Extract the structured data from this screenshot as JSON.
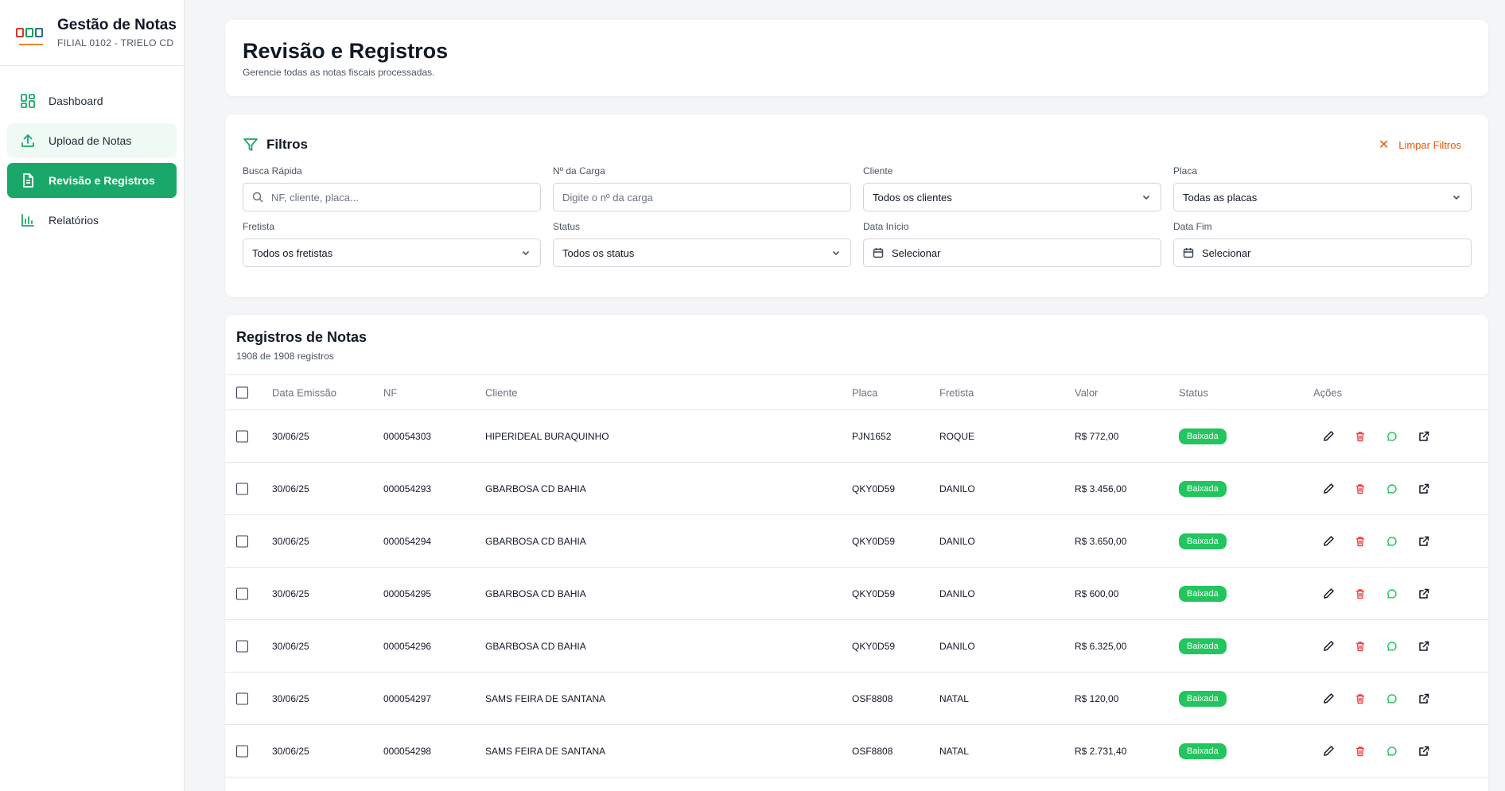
{
  "brand": {
    "title": "Gestão de Notas",
    "subtitle": "FILIAL 0102 - TRIELO CD"
  },
  "sidebar": {
    "items": [
      {
        "label": "Dashboard",
        "icon": "dashboard-grid-icon"
      },
      {
        "label": "Upload de Notas",
        "icon": "upload-icon"
      },
      {
        "label": "Revisão e Registros",
        "icon": "document-icon"
      },
      {
        "label": "Relatórios",
        "icon": "bar-chart-icon"
      }
    ]
  },
  "header": {
    "title": "Revisão e Registros",
    "subtitle": "Gerencie todas as notas fiscais processadas."
  },
  "filters": {
    "title": "Filtros",
    "clear_label": "Limpar Filtros",
    "busca": {
      "label": "Busca Rápida",
      "placeholder": "NF, cliente, placa..."
    },
    "carga": {
      "label": "Nº da Carga",
      "placeholder": "Digite o nº da carga"
    },
    "cliente": {
      "label": "Cliente",
      "value": "Todos os clientes"
    },
    "placa": {
      "label": "Placa",
      "value": "Todas as placas"
    },
    "fretista": {
      "label": "Fretista",
      "value": "Todos os fretistas"
    },
    "status": {
      "label": "Status",
      "value": "Todos os status"
    },
    "data_inicio": {
      "label": "Data Início",
      "value": "Selecionar"
    },
    "data_fim": {
      "label": "Data Fim",
      "value": "Selecionar"
    }
  },
  "table": {
    "title": "Registros de Notas",
    "count": "1908 de 1908 registros",
    "columns": {
      "data": "Data Emissão",
      "nf": "NF",
      "cliente": "Cliente",
      "placa": "Placa",
      "fretista": "Fretista",
      "valor": "Valor",
      "status": "Status",
      "acoes": "Ações"
    },
    "rows": [
      {
        "data": "30/06/25",
        "nf": "000054303",
        "cliente": "HIPERIDEAL BURAQUINHO",
        "placa": "PJN1652",
        "fretista": "ROQUE",
        "valor": "R$ 772,00",
        "status": "Baixada"
      },
      {
        "data": "30/06/25",
        "nf": "000054293",
        "cliente": "GBARBOSA CD BAHIA",
        "placa": "QKY0D59",
        "fretista": "DANILO",
        "valor": "R$ 3.456,00",
        "status": "Baixada"
      },
      {
        "data": "30/06/25",
        "nf": "000054294",
        "cliente": "GBARBOSA CD BAHIA",
        "placa": "QKY0D59",
        "fretista": "DANILO",
        "valor": "R$ 3.650,00",
        "status": "Baixada"
      },
      {
        "data": "30/06/25",
        "nf": "000054295",
        "cliente": "GBARBOSA CD BAHIA",
        "placa": "QKY0D59",
        "fretista": "DANILO",
        "valor": "R$ 600,00",
        "status": "Baixada"
      },
      {
        "data": "30/06/25",
        "nf": "000054296",
        "cliente": "GBARBOSA CD BAHIA",
        "placa": "QKY0D59",
        "fretista": "DANILO",
        "valor": "R$ 6.325,00",
        "status": "Baixada"
      },
      {
        "data": "30/06/25",
        "nf": "000054297",
        "cliente": "SAMS FEIRA DE SANTANA",
        "placa": "OSF8808",
        "fretista": "NATAL",
        "valor": "R$ 120,00",
        "status": "Baixada"
      },
      {
        "data": "30/06/25",
        "nf": "000054298",
        "cliente": "SAMS FEIRA DE SANTANA",
        "placa": "OSF8808",
        "fretista": "NATAL",
        "valor": "R$ 2.731,40",
        "status": "Baixada"
      }
    ]
  },
  "colors": {
    "accent": "#1aa86a",
    "badge": "#22c55e",
    "clear": "#ea580c",
    "delete": "#ef4444",
    "chat": "#22c55e"
  }
}
